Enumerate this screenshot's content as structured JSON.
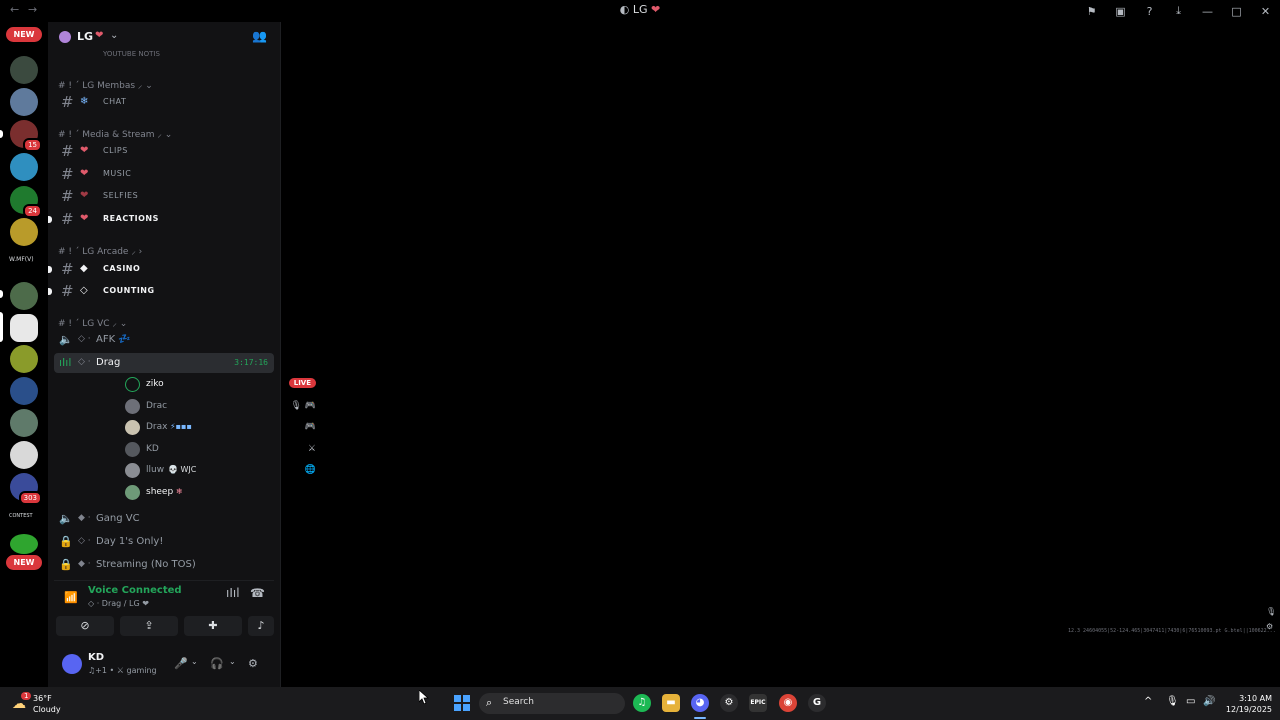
{
  "window": {
    "title": "LG",
    "back_icon": "←",
    "forward_icon": "→",
    "icons": [
      "flag-icon",
      "inbox-icon",
      "help-icon",
      "download-icon"
    ],
    "controls": [
      "—",
      "□",
      "✕"
    ]
  },
  "guild_rail": {
    "top_new_label": "NEW",
    "bottom_new_label": "NEW",
    "badges": [
      "15",
      "24",
      "303"
    ],
    "text_server": "W.MF(V)",
    "text_server_2": "CONTEST"
  },
  "server": {
    "name": "LG",
    "emoji": "❤",
    "chevron": "⌄",
    "invite_icon": "👥"
  },
  "channels": {
    "partial_top": "YOUTUBE NOTIS",
    "categories": [
      {
        "label": "# ! ´ LG Membas ⸝ ⌄"
      },
      {
        "label": "# ! ´ Media & Stream ⸝ ⌄"
      },
      {
        "label": "# ! ´ LG Arcade ⸝ ›"
      },
      {
        "label": "# ! ´ LG VC ⸝ ⌄"
      }
    ],
    "text_channels": [
      {
        "icon": "❄",
        "name": "CHAT",
        "unread": false
      },
      {
        "icon": "❤",
        "name": "CLIPS",
        "unread": false
      },
      {
        "icon": "❤",
        "name": "MUSIC",
        "unread": false
      },
      {
        "icon": "❤",
        "name": "SELFIES",
        "unread": false
      },
      {
        "icon": "❤",
        "name": "REACTIONS",
        "unread": true
      },
      {
        "icon": "◆",
        "name": "CASINO",
        "unread": true
      },
      {
        "icon": "◇",
        "name": "COUNTING",
        "unread": true
      }
    ],
    "voice_channels": [
      {
        "name": "AFK",
        "suffix": "💤"
      },
      {
        "name": "Drag",
        "timer": "3:17:16"
      },
      {
        "name": "Gang VC"
      },
      {
        "name": "Day 1's Only!"
      },
      {
        "name": "Streaming (No TOS)"
      }
    ],
    "voice_users": [
      {
        "name": "ziko",
        "tag": "",
        "right": "LIVE"
      },
      {
        "name": "Drac",
        "tag": "",
        "right": "🎙 🎮"
      },
      {
        "name": "Drax",
        "tag": "⚡▪▪▪",
        "right": "🎮"
      },
      {
        "name": "KD",
        "tag": "",
        "right": "⚔"
      },
      {
        "name": "lluw",
        "tag": "💀 WJC",
        "right": "🌐"
      },
      {
        "name": "sheep",
        "tag": "❄",
        "right": ""
      }
    ]
  },
  "voice_status": {
    "title": "Voice Connected",
    "subtitle": "◇ · Drag / LG ❤",
    "actions": [
      "camera-off-icon",
      "screen-share-icon",
      "activities-icon",
      "soundboard-icon"
    ]
  },
  "user_panel": {
    "name": "KD",
    "status": "♫+1 • ⚔ gaming"
  },
  "overlay": {
    "text": "12.3 24604055|52-124.465|3047411|7430|6|76510093.pt G.btel||100622..."
  },
  "taskbar": {
    "weather_temp": "36°F",
    "weather_cond": "Cloudy",
    "weather_badge": "1",
    "search_placeholder": "Search",
    "time": "3:10 AM",
    "date": "12/19/2025"
  }
}
